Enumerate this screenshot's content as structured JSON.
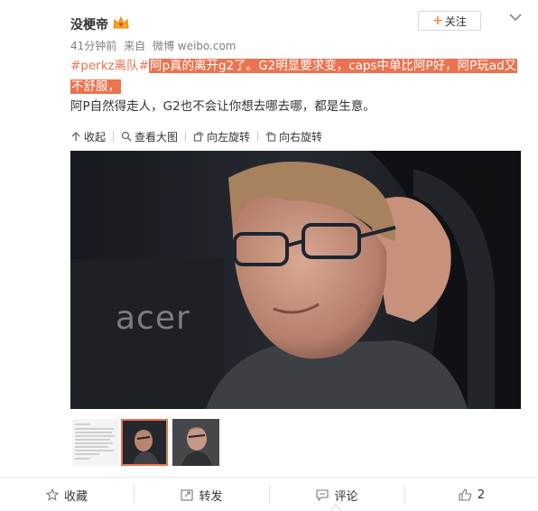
{
  "author": {
    "name": "没梗帝"
  },
  "follow": {
    "label": "关注",
    "plus": "+"
  },
  "meta": {
    "time": "41分钟前",
    "via": "来自",
    "source": "微博 weibo.com"
  },
  "post": {
    "topic": "#perkz离队#",
    "highlight_a": "阿p真的离开g2了。G2明显要求变，caps中单比阿P好，阿P玩ad又",
    "highlight_b": "不舒服，",
    "line2": "阿P自然得走人，G2也不会让你想去哪去哪，都是生意。"
  },
  "media_toolbar": {
    "collapse": "收起",
    "view_large": "查看大图",
    "rotate_left": "向左旋转",
    "rotate_right": "向右旋转"
  },
  "photo": {
    "watermark": "acer"
  },
  "actions": {
    "favorite": "收藏",
    "forward": "转发",
    "comment": "评论",
    "like_count": "2"
  },
  "colors": {
    "accent": "#eb7350",
    "follow_plus": "#ff8140"
  },
  "icons": [
    "crown-badge-icon",
    "chevron-down-icon",
    "collapse-icon",
    "search-icon",
    "rotate-left-icon",
    "rotate-right-icon",
    "star-icon",
    "forward-icon",
    "comment-icon",
    "thumbs-up-icon"
  ]
}
